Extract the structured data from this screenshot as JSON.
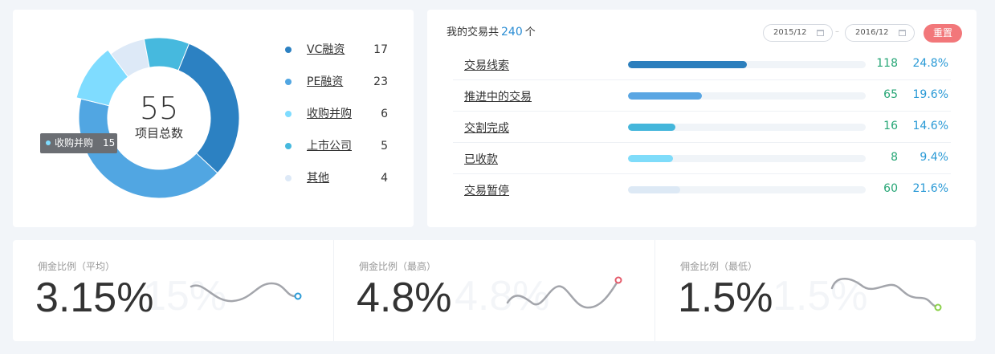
{
  "donut": {
    "total": "55",
    "caption": "项目总数",
    "tooltip": {
      "label": "收购并购",
      "value": "15",
      "color": "#7fdcff"
    },
    "segments": [
      {
        "name": "VC融资",
        "value": 17,
        "color": "#2c81c2"
      },
      {
        "name": "PE融资",
        "value": 23,
        "color": "#51a6e2"
      },
      {
        "name": "收购并购",
        "value": 6,
        "color": "#7fdcff"
      },
      {
        "name": "上市公司",
        "value": 5,
        "color": "#46b9de"
      },
      {
        "name": "其他",
        "value": 4,
        "color": "#dde9f7"
      }
    ]
  },
  "legend": [
    {
      "label": "VC融资",
      "value": "17",
      "color": "#2c81c2"
    },
    {
      "label": "PE融资",
      "value": "23",
      "color": "#51a6e2"
    },
    {
      "label": "收购并购",
      "value": "6",
      "color": "#7fdcff"
    },
    {
      "label": "上市公司",
      "value": "5",
      "color": "#46b9de"
    },
    {
      "label": "其他",
      "value": "4",
      "color": "#dde9f7"
    }
  ],
  "deals": {
    "title_prefix": "我的交易共",
    "total": "240",
    "title_suffix": "个",
    "date_from": "2015/12",
    "date_sep": "–",
    "date_to": "2016/12",
    "reset": "重置",
    "rows": [
      {
        "label": "交易线索",
        "count": "118",
        "pct": "24.8%",
        "fill": 0.5,
        "color": "#2c7fbd"
      },
      {
        "label": "推进中的交易",
        "count": "65",
        "pct": "19.6%",
        "fill": 0.31,
        "color": "#5aa6e3"
      },
      {
        "label": "交割完成",
        "count": "16",
        "pct": "14.6%",
        "fill": 0.2,
        "color": "#44b6db"
      },
      {
        "label": "已收款",
        "count": "8",
        "pct": "9.4%",
        "fill": 0.19,
        "color": "#7fdcfa"
      },
      {
        "label": "交易暂停",
        "count": "60",
        "pct": "21.6%",
        "fill": 0.22,
        "color": "#dde9f5"
      }
    ]
  },
  "stats": [
    {
      "label": "佣金比例（平均）",
      "value": "3.15%",
      "ghost": "15%",
      "dot_color": "#2a9ad6"
    },
    {
      "label": "佣金比例（最高）",
      "value": "4.8%",
      "ghost": "4.8%",
      "dot_color": "#e45a6a"
    },
    {
      "label": "佣金比例（最低）",
      "value": "1.5%",
      "ghost": "1.5%",
      "dot_color": "#8cd14b"
    }
  ]
}
